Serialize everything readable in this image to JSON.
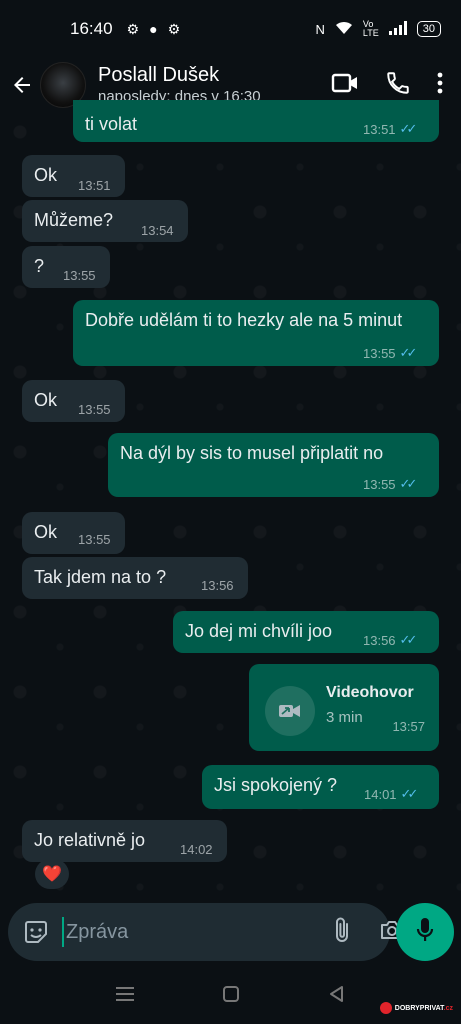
{
  "status_bar": {
    "time": "16:40",
    "battery": "30"
  },
  "header": {
    "contact_name": "Poslall Dušek",
    "last_seen": "naposledy: dnes v 16:30"
  },
  "messages": [
    {
      "dir": "out",
      "text": "ti volat",
      "time": "13:51"
    },
    {
      "dir": "in",
      "text": "Ok",
      "time": "13:51"
    },
    {
      "dir": "in",
      "text": "Můžeme?",
      "time": "13:54"
    },
    {
      "dir": "in",
      "text": "?",
      "time": "13:55"
    },
    {
      "dir": "out",
      "text": "Dobře udělám ti to hezky ale na 5 minut",
      "time": "13:55"
    },
    {
      "dir": "in",
      "text": "Ok",
      "time": "13:55"
    },
    {
      "dir": "out",
      "text": "Na dýl by sis to musel připlatit no",
      "time": "13:55"
    },
    {
      "dir": "in",
      "text": "Ok",
      "time": "13:55"
    },
    {
      "dir": "in",
      "text": "Tak jdem na to ?",
      "time": "13:56"
    },
    {
      "dir": "out",
      "text": "Jo dej mi chvíli joo",
      "time": "13:56"
    },
    {
      "dir": "out",
      "text": "Jsi spokojený ?",
      "time": "14:01"
    },
    {
      "dir": "in",
      "text": "Jo relativně jo",
      "time": "14:02"
    }
  ],
  "video_call": {
    "title": "Videohovor",
    "duration": "3 min",
    "time": "13:57"
  },
  "reaction": "❤️",
  "composer": {
    "placeholder": "Zpráva"
  },
  "watermark": {
    "prefix": "DOBRY",
    "suffix": "PRIVAT",
    "tld": ".cz"
  },
  "colors": {
    "incoming": "#202c33",
    "outgoing": "#005c4b",
    "accent": "#00a884",
    "read_ticks": "#53bdeb"
  }
}
